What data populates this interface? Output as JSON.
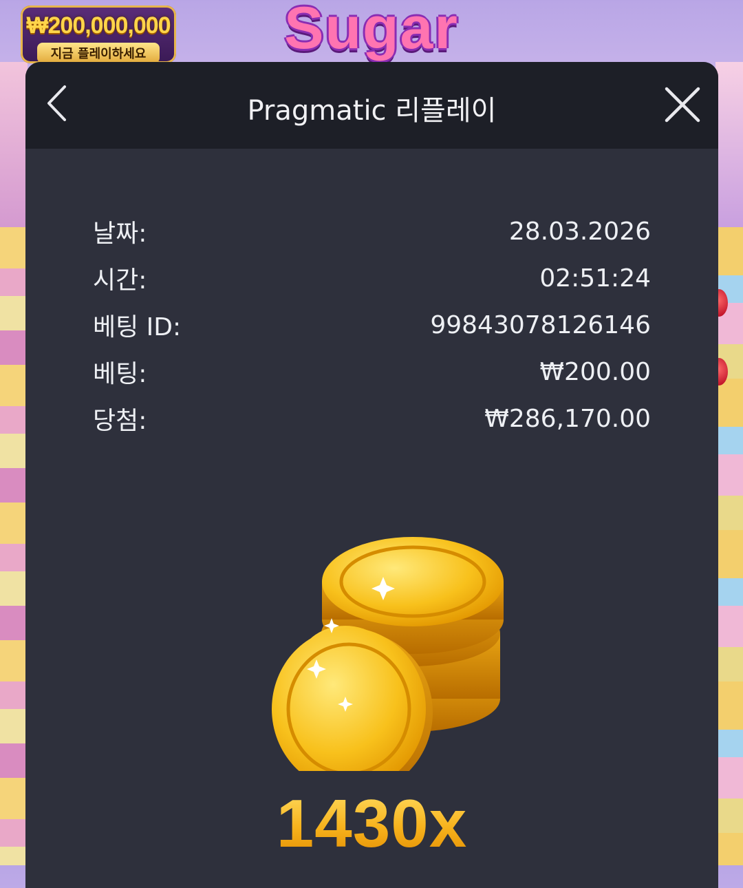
{
  "background": {
    "jackpot_amount": "₩200,000,000",
    "jackpot_cta": "지금 플레이하세요",
    "logo_text": "Sugar"
  },
  "modal": {
    "title": "Pragmatic 리플레이",
    "back_icon": "chevron-left-icon",
    "close_icon": "close-icon",
    "rows": [
      {
        "label": "날짜:",
        "value": "28.03.2026"
      },
      {
        "label": "시간:",
        "value": "02:51:24"
      },
      {
        "label": "베팅 ID:",
        "value": "99843078126146"
      },
      {
        "label": "베팅:",
        "value": "₩200.00"
      },
      {
        "label": "당첨:",
        "value": "₩286,170.00"
      }
    ],
    "illustration": "gold-coins-icon",
    "multiplier": "1430x"
  },
  "colors": {
    "modal_bg": "#2e303c",
    "header_bg": "#1d1f27",
    "multiplier": "#f9c02c"
  }
}
